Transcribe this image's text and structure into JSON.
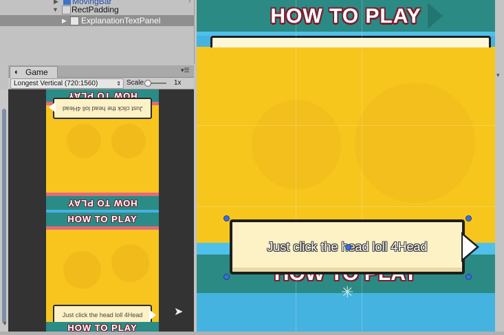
{
  "hierarchy": {
    "items": [
      {
        "label": "MovingBar"
      },
      {
        "label": "RectPadding"
      },
      {
        "label": "ExplanationTextPanel"
      }
    ]
  },
  "game_panel": {
    "tab_label": "Game",
    "resolution": "Longest Vertical (720:1560)",
    "scale_label": "Scale",
    "scale_value": "1x",
    "preview": {
      "title_top": "HOW TO PLAY",
      "title_mid_flipped": "HOW TO PLAY",
      "title_mid": "HOW TO PLAY",
      "title_bottom": "HOW TO PLAY",
      "text_flipped": "Just click the head loll 4Head",
      "text": "Just click the head loll 4Head"
    }
  },
  "scene": {
    "title": "HOW TO PLAY",
    "lower_title": "HOW TO PLAY",
    "explanation_text": "Just click the head loll 4Head"
  },
  "colors": {
    "teal": "#2c8a84",
    "yellow": "#f6c61d",
    "sky": "#45b3e0",
    "title_outline": "#7a2131",
    "panel_bg": "#fdf1c6"
  }
}
